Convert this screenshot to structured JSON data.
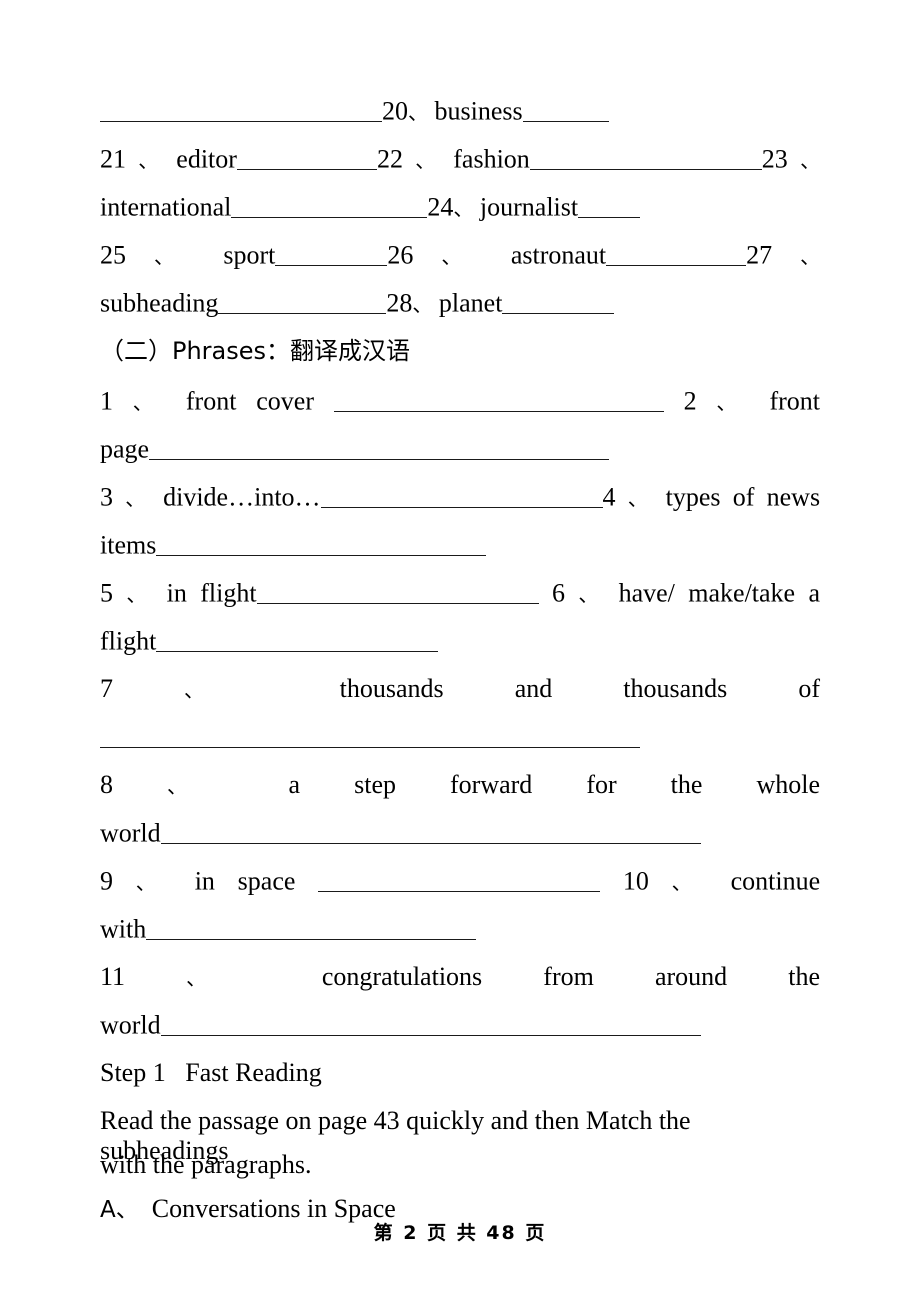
{
  "document": {
    "page_number_label": "第 2 页 共 48 页",
    "page_current": "2",
    "page_total": "48"
  },
  "words_section": {
    "line1": {
      "num": "20",
      "sep": "、",
      "word": "business"
    },
    "line2": {
      "n21": "21",
      "w21": "editor",
      "n22": "22",
      "w22": "fashion",
      "n23": "23"
    },
    "line3": {
      "w23": "international",
      "n24": "24",
      "w24": "journalist"
    },
    "line4": {
      "n25": "25",
      "w25": "sport",
      "n26": "26",
      "w26": "astronaut",
      "n27": "27"
    },
    "line5": {
      "w27": "subheading",
      "n28": "28",
      "w28": "planet"
    }
  },
  "phrases_section": {
    "heading": "（二）Phrases：翻译成汉语",
    "items": [
      {
        "num": "1",
        "sep": "、",
        "text": "front cover"
      },
      {
        "num": "2",
        "sep": "、",
        "text": "front page"
      },
      {
        "num": "3",
        "sep": "、",
        "text": "divide…into…"
      },
      {
        "num": "4",
        "sep": "、",
        "text": "types of news items"
      },
      {
        "num": "5",
        "sep": "、",
        "text": "in flight"
      },
      {
        "num": "6",
        "sep": "、",
        "text": "have/ make/take a flight"
      },
      {
        "num": "7",
        "sep": "、",
        "text": "thousands and thousands of"
      },
      {
        "num": "8",
        "sep": "、",
        "text": "a step forward for the whole world"
      },
      {
        "num": "9",
        "sep": "、",
        "text": "in space"
      },
      {
        "num": "10",
        "sep": "、",
        "text": "continue with"
      },
      {
        "num": "11",
        "sep": "、",
        "text": "congratulations from around the world"
      }
    ],
    "tokens": {
      "p1_a": "1",
      "p1_b": "、",
      "p1_c": "front",
      "p1_d": "cover",
      "p2_a": "2",
      "p2_b": "、",
      "p2_c": "front",
      "p2_d": "page",
      "p3_a": "3",
      "p3_b": "、",
      "p3_c": "divide…into…",
      "p4_a": "4",
      "p4_b": "、",
      "p4_c": "types",
      "p4_d": "of",
      "p4_e": "news",
      "p4_f": "items",
      "p5_a": "5",
      "p5_b": "、",
      "p5_c": "in",
      "p5_d": "flight",
      "p6_a": "6",
      "p6_b": "、",
      "p6_c": "have/",
      "p6_d": "make/take",
      "p6_e": "a",
      "p6_f": "flight",
      "p7_a": "7",
      "p7_b": "、",
      "p7_c": "thousands",
      "p7_d": "and",
      "p7_e": "thousands",
      "p7_f": "of",
      "p8_a": "8",
      "p8_b": "、",
      "p8_c": "a",
      "p8_d": "step",
      "p8_e": "forward",
      "p8_f": "for",
      "p8_g": "the",
      "p8_h": "whole",
      "p8_i": "world",
      "p9_a": "9",
      "p9_b": "、",
      "p9_c": "in",
      "p9_d": "space",
      "p10_a": "10",
      "p10_b": "、",
      "p10_c": "continue",
      "p10_d": "with",
      "p11_a": "11",
      "p11_b": "、",
      "p11_c": "congratulations",
      "p11_d": "from",
      "p11_e": "around",
      "p11_f": "the",
      "p11_g": "world"
    }
  },
  "step_section": {
    "step_label": "Step 1",
    "step_title": "Fast Reading",
    "instruction_line1": "Read the passage on page 43 quickly and then Match the subheadings",
    "instruction_line2": "with the paragraphs.",
    "option_a_letter": "A、",
    "option_a_text": "Conversations in Space"
  }
}
